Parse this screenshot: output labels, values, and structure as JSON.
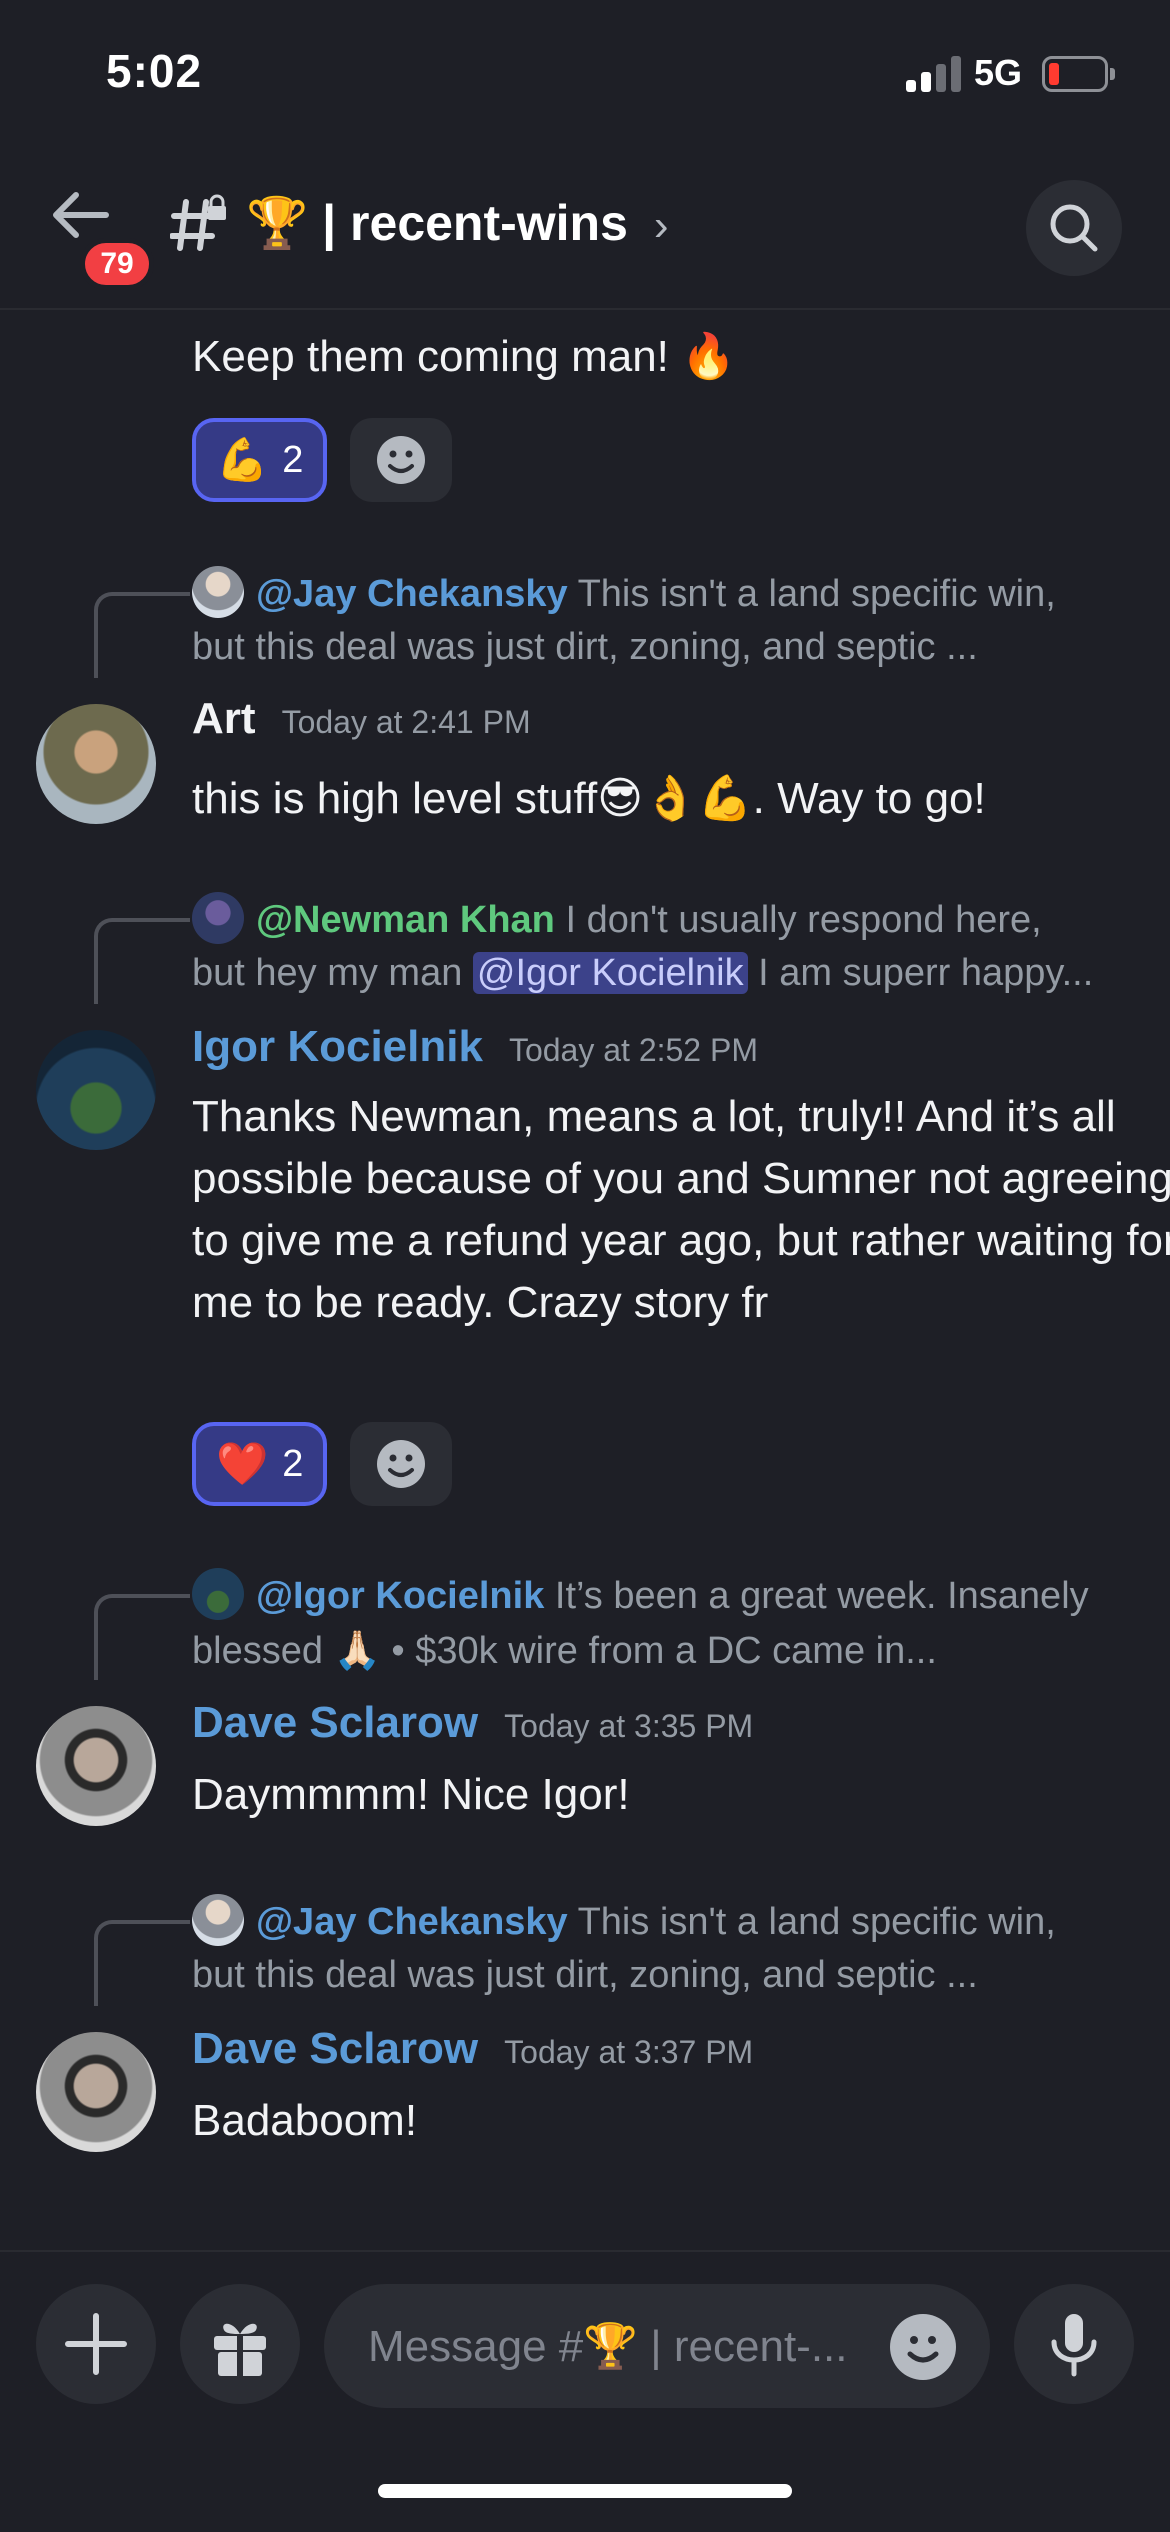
{
  "status_bar": {
    "time": "5:02",
    "network": "5G"
  },
  "header": {
    "unread_badge": "79",
    "channel_prefix_emoji": "🏆",
    "channel_name": "| recent-wins",
    "chevron": "›"
  },
  "messages": [
    {
      "type": "continuation",
      "text": "Keep them coming man! 🔥",
      "reactions": [
        {
          "emoji": "💪",
          "count": "2"
        }
      ]
    },
    {
      "reply": {
        "mention": "@Jay Chekansky",
        "preview_line1": "This isn't a land specific win,",
        "preview_line2": "but this deal was just dirt, zoning, and septic ..."
      },
      "author": "Art",
      "timestamp": "Today at 2:41 PM",
      "text": "this is high level stuff😎👌💪. Way to go!"
    },
    {
      "reply": {
        "mention": "@Newman Khan",
        "preview_line1": "I don't usually respond here,",
        "preview_line2_before": "but hey my man ",
        "preview_line2_mention": "@Igor Kocielnik",
        "preview_line2_after": " I am superr happy..."
      },
      "author": "Igor Kocielnik",
      "timestamp": "Today at 2:52 PM",
      "text": "Thanks Newman, means a lot, truly!! And it’s all possible because of you and Sumner not agreeing to give me a refund year ago, but rather waiting for me to be ready. Crazy story fr",
      "reactions": [
        {
          "emoji": "❤️",
          "count": "2"
        }
      ]
    },
    {
      "reply": {
        "mention": "@Igor Kocielnik",
        "preview_line1": "It’s been a great week. Insanely",
        "preview_line2": "blessed 🙏🏻 •  $30k wire from a DC came in..."
      },
      "author": "Dave Sclarow",
      "timestamp": "Today at 3:35 PM",
      "text": "Daymmmm! Nice Igor!"
    },
    {
      "reply": {
        "mention": "@Jay Chekansky",
        "preview_line1": "This isn't a land specific win,",
        "preview_line2": "but this deal was just dirt, zoning, and septic ..."
      },
      "author": "Dave Sclarow",
      "timestamp": "Today at 3:37 PM",
      "text": "Badaboom!"
    }
  ],
  "composer": {
    "placeholder": "Message #🏆 | recent-..."
  },
  "colors": {
    "background": "#1e1f26",
    "author_blue": "#5b9bd8",
    "mention_green": "#5fc97e",
    "reaction_bg": "#353a86",
    "reaction_border": "#5865f2",
    "badge_red": "#f23f43"
  },
  "icons": [
    "back-arrow-icon",
    "locked-channel-icon",
    "search-icon",
    "plus-icon",
    "gift-icon",
    "emoji-icon",
    "microphone-icon",
    "add-reaction-icon"
  ]
}
